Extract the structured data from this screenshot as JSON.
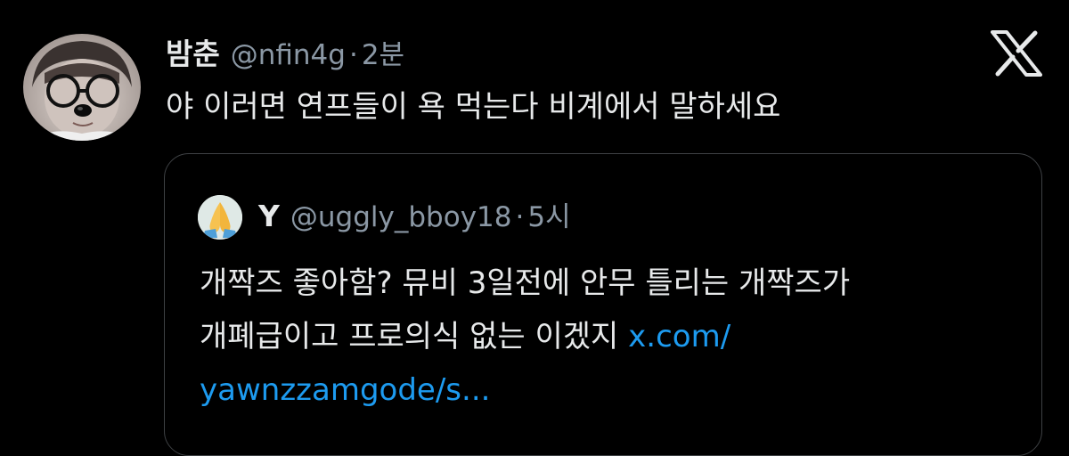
{
  "tweet": {
    "author_name": "밤춘",
    "author_handle": "@nfin4g",
    "separator": "·",
    "time": "2분",
    "text": "야 이러면 연프들이 욕 먹는다 비계에서 말하세요",
    "platform_icon": "x-logo-icon",
    "avatar_icon": "profile-photo-with-glasses"
  },
  "quoted": {
    "author_name": "Y",
    "author_handle": "@uggly_bboy18",
    "separator": "·",
    "time": "5시",
    "avatar_icon": "folded-hands-emoji",
    "text_line1": "개짝즈 좋아함? 뮤비 3일전에 안무 틀리는 개짝즈가",
    "text_line2": "개폐급이고 프로의식 없는 이겠지 ",
    "link_part1": "x.com/",
    "link_part2": "yawnzzamgode/s..."
  },
  "colors": {
    "background": "#000000",
    "text": "#e7e9ea",
    "muted": "#8b98a5",
    "link": "#1d9bf0",
    "border": "#3e4144"
  }
}
